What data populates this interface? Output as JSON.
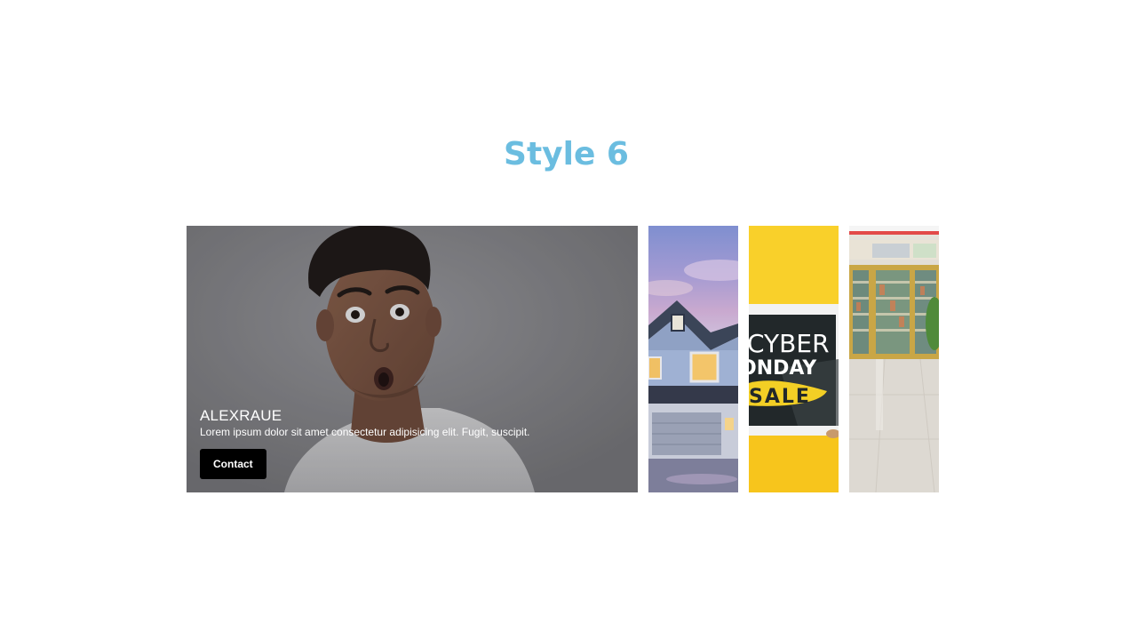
{
  "heading": "Style 6",
  "colors": {
    "heading": "#6bbde0",
    "button_bg": "#000000",
    "button_text": "#ffffff",
    "cyber_yellow": "#f8c81d"
  },
  "featured": {
    "title": "ALEXRAUE",
    "description": "Lorem ipsum dolor sit amet consectetur adipisicing elit. Fugit, suscipit.",
    "button_label": "Contact"
  },
  "panels": [
    {
      "name": "house-photo"
    },
    {
      "name": "cyber-monday-photo",
      "sign_lines": [
        "CYBER",
        "ONDAY",
        "SALE"
      ]
    },
    {
      "name": "store-aisle-photo"
    }
  ]
}
